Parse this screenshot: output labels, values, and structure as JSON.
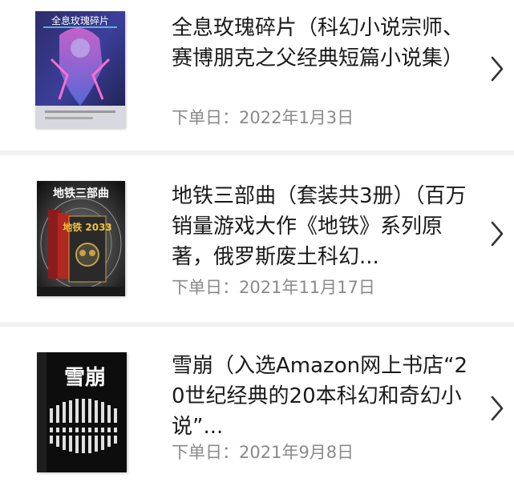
{
  "orders": [
    {
      "title": "全息玫瑰碎片（科幻小说宗师、赛博朋克之父经典短篇小说集）",
      "date_label": "下单日：",
      "date": "2022年1月3日",
      "cover_text": "全息玫瑰碎片"
    },
    {
      "title": "地铁三部曲（套装共3册）（百万销量游戏大作《地铁》系列原著，俄罗斯废土科幻...",
      "date_label": "下单日：",
      "date": "2021年11月17日",
      "cover_text": "地铁三部曲",
      "cover_subtext": "地铁 2033"
    },
    {
      "title": "雪崩（入选Amazon网上书店“20世纪经典的20本科幻和奇幻小说”...",
      "date_label": "下单日：",
      "date": "2021年9月8日",
      "cover_text": "雪崩"
    }
  ],
  "colors": {
    "divider": "#f1f1f1",
    "date_text": "#8a8a8a",
    "title_text": "#1a1a1a",
    "chevron": "#333333"
  }
}
